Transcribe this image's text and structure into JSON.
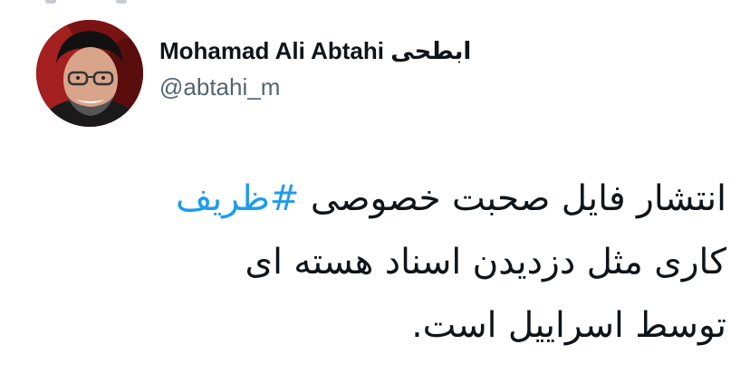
{
  "author": {
    "display_name": "Mohamad Ali Abtahi ابطحی",
    "handle": "@abtahi_m",
    "avatar_alt": "avatar"
  },
  "tweet": {
    "line1_text": "انتشار فایل صحبت خصوصی ",
    "hashtag": "#ظریف",
    "line2": "کاری مثل دزدیدن اسناد هسته ای",
    "line3": "توسط اسراییل است."
  },
  "colors": {
    "text": "#0f1419",
    "muted": "#536471",
    "link": "#1d9bf0",
    "background": "#ffffff"
  }
}
